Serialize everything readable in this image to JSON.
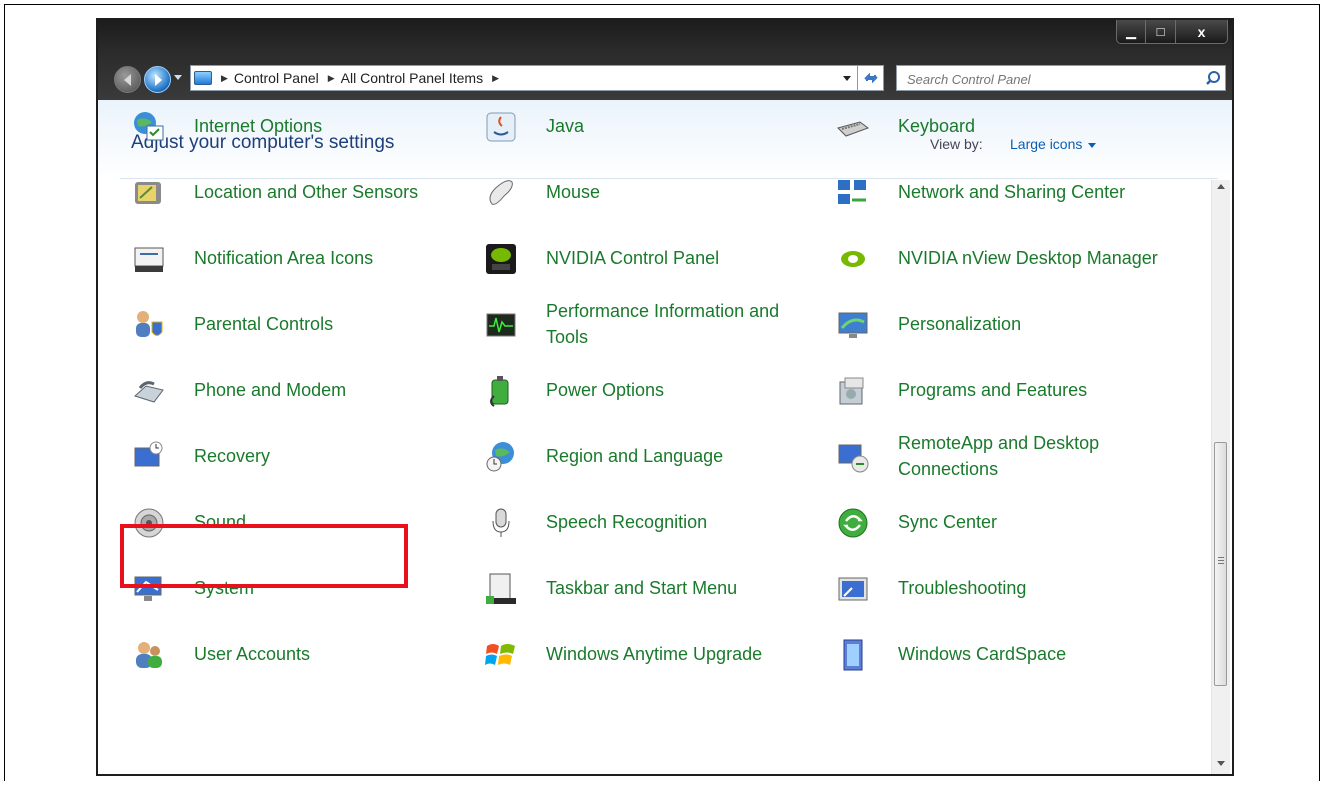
{
  "window": {
    "controls": {
      "minimize": "▁",
      "maximize": "□",
      "close": "x"
    }
  },
  "address": {
    "crumbs": [
      "Control Panel",
      "All Control Panel Items"
    ],
    "search_placeholder": "Search Control Panel"
  },
  "header": {
    "title": "Adjust your computer's settings",
    "view_by_label": "View by:",
    "view_by_value": "Large icons"
  },
  "items": [
    {
      "label": "Internet Options",
      "icon": "internet-options-icon"
    },
    {
      "label": "Java",
      "icon": "java-icon"
    },
    {
      "label": "Keyboard",
      "icon": "keyboard-icon"
    },
    {
      "label": "Location and Other Sensors",
      "icon": "location-sensors-icon"
    },
    {
      "label": "Mouse",
      "icon": "mouse-icon"
    },
    {
      "label": "Network and Sharing Center",
      "icon": "network-icon"
    },
    {
      "label": "Notification Area Icons",
      "icon": "notification-area-icon"
    },
    {
      "label": "NVIDIA Control Panel",
      "icon": "nvidia-icon"
    },
    {
      "label": "NVIDIA nView Desktop Manager",
      "icon": "nview-icon"
    },
    {
      "label": "Parental Controls",
      "icon": "parental-controls-icon"
    },
    {
      "label": "Performance Information and Tools",
      "icon": "performance-icon"
    },
    {
      "label": "Personalization",
      "icon": "personalization-icon"
    },
    {
      "label": "Phone and Modem",
      "icon": "phone-modem-icon"
    },
    {
      "label": "Power Options",
      "icon": "power-options-icon"
    },
    {
      "label": "Programs and Features",
      "icon": "programs-features-icon"
    },
    {
      "label": "Recovery",
      "icon": "recovery-icon"
    },
    {
      "label": "Region and Language",
      "icon": "region-language-icon"
    },
    {
      "label": "RemoteApp and Desktop Connections",
      "icon": "remoteapp-icon"
    },
    {
      "label": "Sound",
      "icon": "sound-icon"
    },
    {
      "label": "Speech Recognition",
      "icon": "microphone-icon"
    },
    {
      "label": "Sync Center",
      "icon": "sync-icon"
    },
    {
      "label": "System",
      "icon": "system-icon"
    },
    {
      "label": "Taskbar and Start Menu",
      "icon": "taskbar-icon"
    },
    {
      "label": "Troubleshooting",
      "icon": "troubleshooting-icon"
    },
    {
      "label": "User Accounts",
      "icon": "user-accounts-icon"
    },
    {
      "label": "Windows Anytime Upgrade",
      "icon": "windows-flag-icon"
    },
    {
      "label": "Windows CardSpace",
      "icon": "cardspace-icon"
    }
  ],
  "colors": {
    "link_green": "#1a7a2c",
    "title_blue": "#1f3f7a",
    "highlight_red": "#e8101a"
  }
}
